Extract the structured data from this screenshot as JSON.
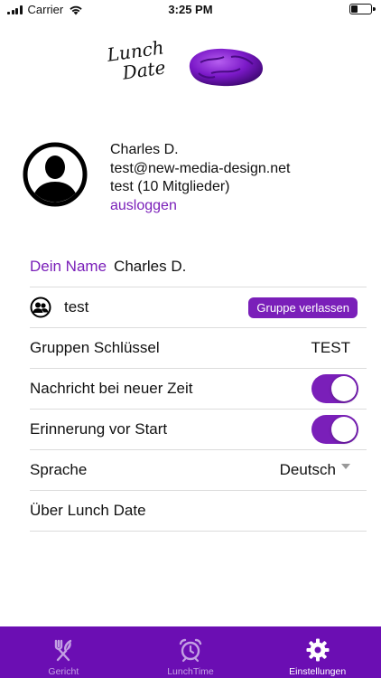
{
  "status_bar": {
    "carrier": "Carrier",
    "time": "3:25 PM"
  },
  "logo": {
    "line1": "Lunch",
    "line2": "Date"
  },
  "profile": {
    "name": "Charles D.",
    "email": "test@new-media-design.net",
    "group": "test (10 Mitglieder)",
    "logout": "ausloggen"
  },
  "settings": {
    "name_label": "Dein Name",
    "name_value": "Charles D.",
    "group_name": "test",
    "leave_group": "Gruppe verlassen",
    "group_key_label": "Gruppen Schlüssel",
    "group_key_value": "TEST",
    "notify_label": "Nachricht bei neuer Zeit",
    "notify_on": true,
    "reminder_label": "Erinnerung vor Start",
    "reminder_on": true,
    "language_label": "Sprache",
    "language_value": "Deutsch",
    "about_label": "Über Lunch Date"
  },
  "tabs": [
    {
      "label": "Gericht",
      "icon": "fork-knife-icon",
      "active": false
    },
    {
      "label": "LunchTime",
      "icon": "alarm-clock-icon",
      "active": false
    },
    {
      "label": "Einstellungen",
      "icon": "gear-icon",
      "active": true
    }
  ],
  "colors": {
    "accent": "#7a1fb9",
    "tabbar": "#6b0eb3"
  }
}
